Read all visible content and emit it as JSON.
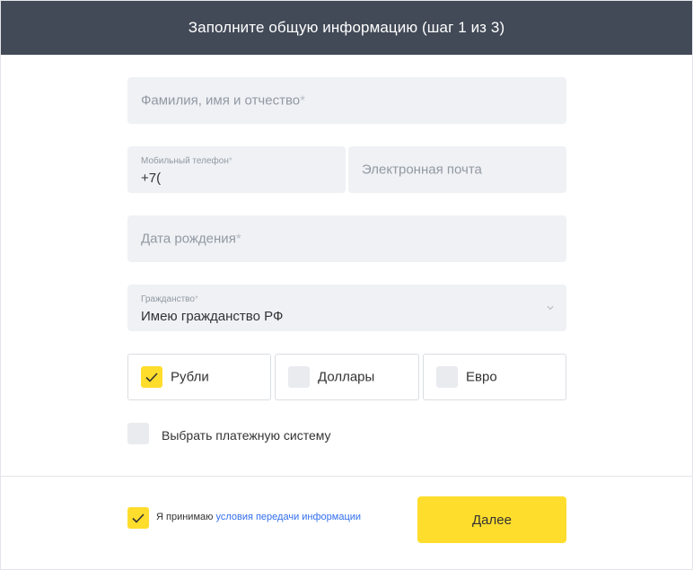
{
  "header": {
    "title": "Заполните общую информацию (шаг 1 из 3)"
  },
  "form": {
    "full_name": {
      "placeholder": "Фамилия, имя и отчество",
      "required_mark": "*"
    },
    "phone": {
      "label": "Мобильный телефон",
      "required_mark": "*",
      "value": "+7("
    },
    "email": {
      "placeholder": "Электронная почта"
    },
    "birth_date": {
      "placeholder": "Дата рождения",
      "required_mark": "*"
    },
    "citizenship": {
      "label": "Гражданство",
      "required_mark": "*",
      "value": "Имею гражданство РФ",
      "icon": "chevron-down-icon"
    }
  },
  "currencies": [
    {
      "label": "Рубли",
      "checked": true
    },
    {
      "label": "Доллары",
      "checked": false
    },
    {
      "label": "Евро",
      "checked": false
    }
  ],
  "payment_system": {
    "label": "Выбрать платежную систему",
    "checked": false
  },
  "consent": {
    "prefix": "Я принимаю",
    "link": "условия передачи информации",
    "checked": true
  },
  "next_button": {
    "label": "Далее"
  },
  "colors": {
    "header_bg": "#424a57",
    "accent": "#ffdd2d",
    "field_bg": "#eff1f5",
    "link": "#336fee"
  }
}
